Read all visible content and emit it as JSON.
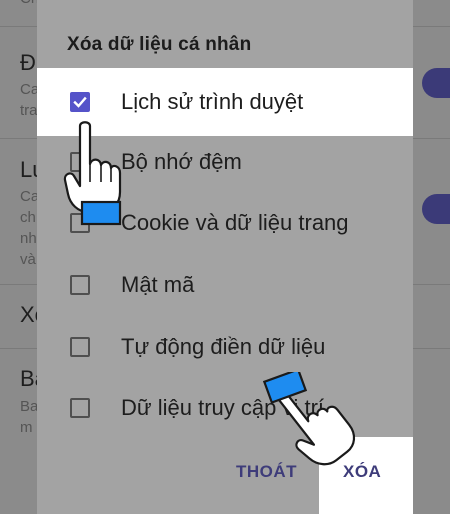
{
  "background": {
    "rows": [
      {
        "title": "Đ",
        "sub": [
          "Ca",
          "tra"
        ]
      },
      {
        "title": "Lu",
        "sub": [
          "Ca",
          "ch",
          "nh",
          "và"
        ]
      },
      {
        "title": "Xó",
        "sub": []
      },
      {
        "title": "Ba",
        "sub": [
          "Ba",
          "m"
        ]
      }
    ],
    "top_text": "Ch..."
  },
  "dialog": {
    "title": "Xóa dữ liệu cá nhân",
    "options": [
      {
        "label": "Lịch sử trình duyệt",
        "checked": true
      },
      {
        "label": "Bộ nhớ đệm",
        "checked": false
      },
      {
        "label": "Cookie và dữ liệu trang",
        "checked": false
      },
      {
        "label": "Mật mã",
        "checked": false
      },
      {
        "label": "Tự động điền dữ liệu",
        "checked": false
      },
      {
        "label": "Dữ liệu truy cập vị trí",
        "checked": false
      }
    ],
    "cancel_label": "THOÁT",
    "confirm_label": "XÓA"
  },
  "colors": {
    "accent": "#5553c9",
    "button_text": "#3e3c7a",
    "pointer_cuff": "#1e8cf0"
  },
  "icons": [
    "checkmark-icon",
    "pointing-hand-icon"
  ]
}
